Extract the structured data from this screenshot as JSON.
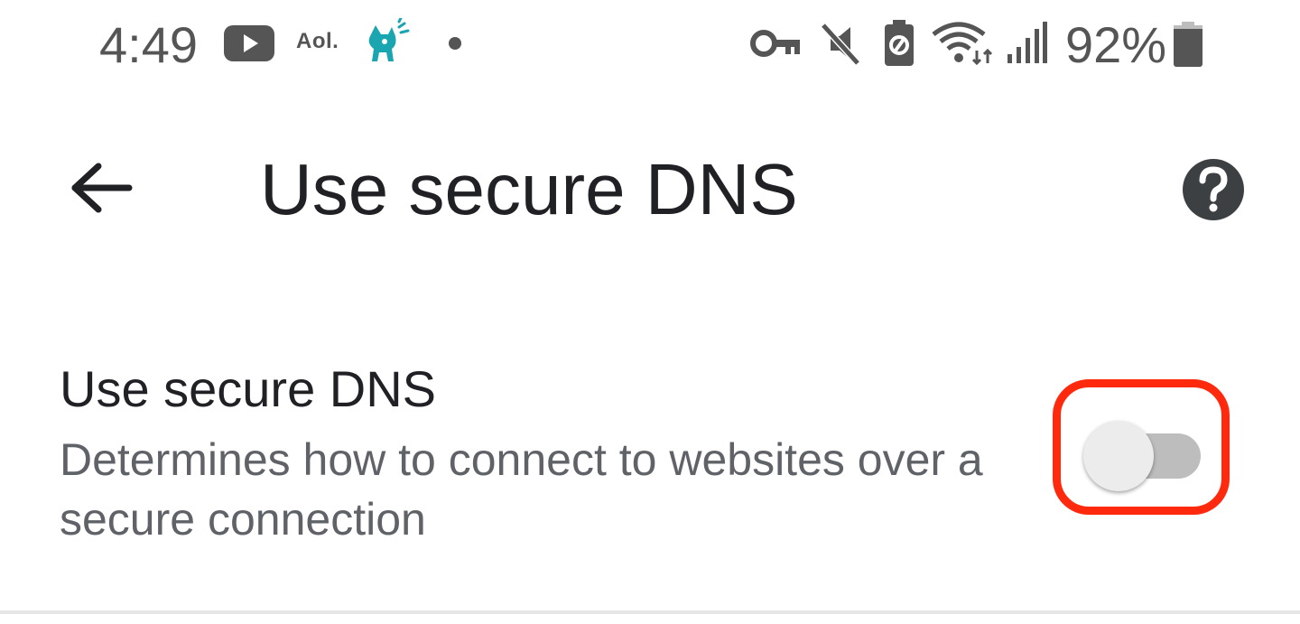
{
  "status_bar": {
    "time": "4:49",
    "aol_label": "Aol.",
    "battery_percent": "92%",
    "icons": [
      "youtube-icon",
      "aol-icon",
      "dog-app-icon",
      "notification-dot-icon",
      "vpn-key-icon",
      "mute-icon",
      "battery-saver-icon",
      "wifi-icon",
      "signal-icon",
      "battery-icon"
    ]
  },
  "app_bar": {
    "title": "Use secure DNS",
    "back_icon": "arrow-back-icon",
    "help_icon": "help-icon"
  },
  "setting": {
    "title": "Use secure DNS",
    "description": "Determines how to connect to websites over a secure connection",
    "toggle_on": false
  },
  "colors": {
    "text_primary": "#202124",
    "text_secondary": "#5f6368",
    "status_icons": "#555555",
    "highlight": "#ff2a0e",
    "dog_icon": "#1aa6b0",
    "toggle_track": "#bdbdbd",
    "toggle_thumb": "#ececec"
  }
}
